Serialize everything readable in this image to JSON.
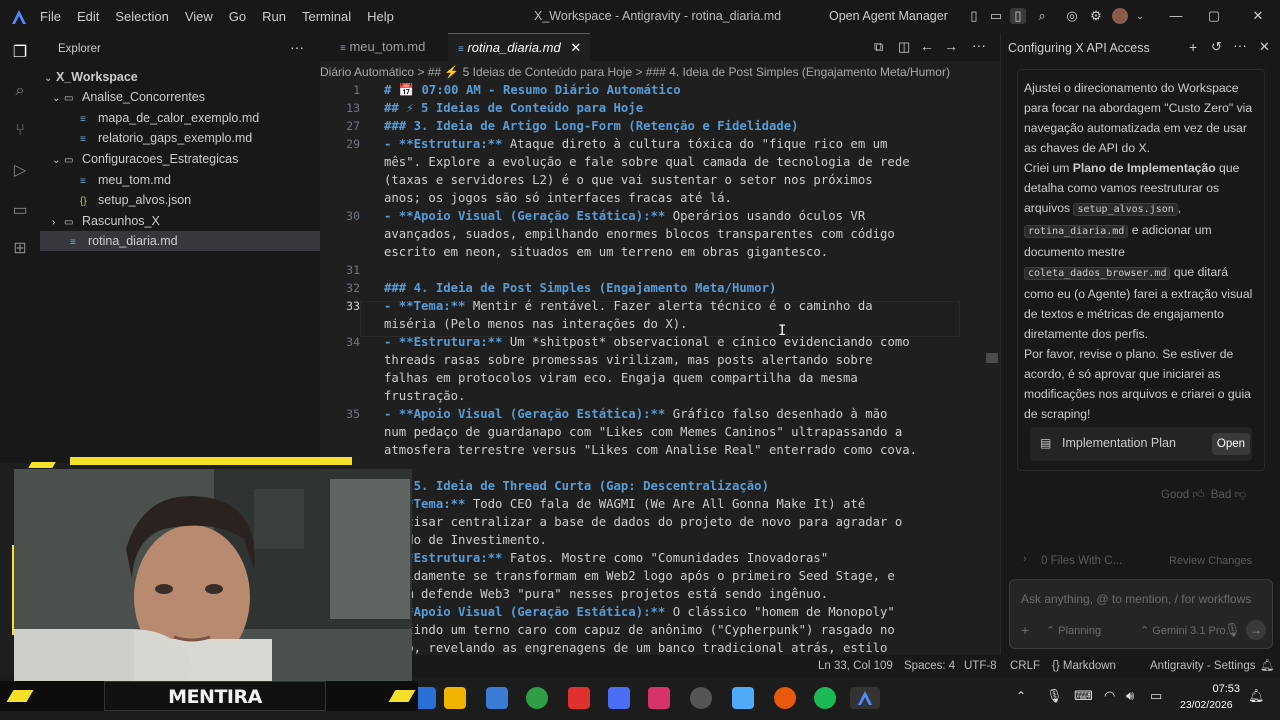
{
  "titlebar": {
    "menu": [
      "File",
      "Edit",
      "Selection",
      "View",
      "Go",
      "Run",
      "Terminal",
      "Help"
    ],
    "title": "X_Workspace - Antigravity - rotina_diaria.md",
    "agent_manager": "Open Agent Manager"
  },
  "explorer": {
    "title": "Explorer",
    "root": "X_Workspace",
    "items": [
      {
        "label": "Analise_Concorrentes",
        "type": "folder",
        "open": true
      },
      {
        "label": "mapa_de_calor_exemplo.md",
        "type": "md"
      },
      {
        "label": "relatorio_gaps_exemplo.md",
        "type": "md"
      },
      {
        "label": "Configuracoes_Estrategicas",
        "type": "folder",
        "open": true
      },
      {
        "label": "meu_tom.md",
        "type": "md"
      },
      {
        "label": "setup_alvos.json",
        "type": "json"
      },
      {
        "label": "Rascunhos_X",
        "type": "folder",
        "open": false
      },
      {
        "label": "rotina_diaria.md",
        "type": "md",
        "selected": true
      }
    ]
  },
  "editor": {
    "tabs": [
      {
        "label": "meu_tom.md",
        "active": false
      },
      {
        "label": "rotina_diaria.md",
        "active": true
      }
    ],
    "breadcrumb": "Diário Automático > ## ⚡ 5 Ideias de Conteúdo para Hoje > ### 4. Ideia de Post Simples (Engajamento Meta/Humor)",
    "lines": [
      {
        "n": "1",
        "text": "# 📅 07:00 AM - Resumo Diário Automático",
        "heading": true
      },
      {
        "n": "13",
        "text": "## ⚡ 5 Ideias de Conteúdo para Hoje",
        "heading": true
      },
      {
        "n": "27",
        "text": "### 3. Ideia de Artigo Long-Form (Retenção e Fidelidade)",
        "heading": true
      },
      {
        "n": "29",
        "bold": "- **Estrutura:**",
        "text": " Ataque direto à cultura tóxica do \"fique rico em um"
      },
      {
        "n": "",
        "text": "mês\". Explore a evolução e fale sobre qual camada de tecnologia de rede"
      },
      {
        "n": "",
        "text": "(taxas e servidores L2) é o que vai sustentar o setor nos próximos"
      },
      {
        "n": "",
        "text": "anos; os jogos são só interfaces fracas até lá."
      },
      {
        "n": "30",
        "bold": "- **Apoio Visual (Geração Estática):**",
        "text": " Operários usando óculos VR"
      },
      {
        "n": "",
        "text": "avançados, suados, empilhando enormes blocos transparentes com código"
      },
      {
        "n": "",
        "text": "escrito em neon, situados em um terreno em obras gigantesco."
      },
      {
        "n": "31",
        "text": ""
      },
      {
        "n": "32",
        "text": "### 4. Ideia de Post Simples (Engajamento Meta/Humor)",
        "heading": true
      },
      {
        "n": "33",
        "bold": "- **Tema:**",
        "text": " Mentir é rentável. Fazer alerta técnico é o caminho da"
      },
      {
        "n": "",
        "text": "miséria (Pelo menos nas interações do X)."
      },
      {
        "n": "34",
        "bold": "- **Estrutura:**",
        "text": " Um *shitpost* observacional e cínico evidenciando como"
      },
      {
        "n": "",
        "text": "threads rasas sobre promessas virilizam, mas posts alertando sobre"
      },
      {
        "n": "",
        "text": "falhas em protocolos viram eco. Engaja quem compartilha da mesma"
      },
      {
        "n": "",
        "text": "frustração."
      },
      {
        "n": "35",
        "bold": "- **Apoio Visual (Geração Estática):**",
        "text": " Gráfico falso desenhado à mão"
      },
      {
        "n": "",
        "text": "num pedaço de guardanapo com \"Likes com Memes Caninos\" ultrapassando a"
      },
      {
        "n": "",
        "text": "atmosfera terrestre versus \"Likes com Analise Real\" enterrado como cova."
      },
      {
        "n": "",
        "text": ""
      },
      {
        "n": "",
        "text": "### 5. Ideia de Thread Curta (Gap: Descentralização)",
        "heading": true
      },
      {
        "n": "",
        "bold": "- **Tema:**",
        "text": " Todo CEO fala de WAGMI (We Are All Gonna Make It) até"
      },
      {
        "n": "",
        "text": "precisar centralizar a base de dados do projeto de novo para agradar o"
      },
      {
        "n": "",
        "text": "Fundo de Investimento."
      },
      {
        "n": "",
        "bold": "- **Estrutura:**",
        "text": " Fatos. Mostre como \"Comunidades Inovadoras\""
      },
      {
        "n": "",
        "text": "rapidamente se transformam em Web2 logo após o primeiro Seed Stage, e"
      },
      {
        "n": "",
        "text": "quem defende Web3 \"pura\" nesses projetos está sendo ingênuo."
      },
      {
        "n": "",
        "bold": "- **Apoio Visual (Geração Estática):**",
        "text": " O clássico \"homem de Monopoly\""
      },
      {
        "n": "",
        "text": "vestindo um terno caro com capuz de anônimo (\"Cypherpunk\") rasgado no"
      },
      {
        "n": "",
        "text": "meio, revelando as engrenagens de um banco tradicional atrás, estilo"
      }
    ]
  },
  "agent": {
    "title": "Configuring X API Access",
    "message": {
      "p1": "Ajustei o direcionamento do Workspace para focar na abordagem \"Custo Zero\" via navegação automatizada em vez de usar as chaves de API do X.",
      "p2_a": "Criei um ",
      "p2_b": "Plano de Implementação",
      "p2_c": " que detalha como vamos reestruturar os arquivos ",
      "file1": "setup_alvos.json",
      "file2": "rotina_diaria.md",
      "p2_d": " e adicionar um documento mestre ",
      "file3": "coleta_dados_browser.md",
      "p2_e": " que ditará como eu (o Agente) farei a extração visual de textos e métricas de engajamento diretamente dos perfis.",
      "p3": "Por favor, revise o plano. Se estiver de acordo, é só aprovar que iniciarei as modificações nos arquivos e criarei o guia de scraping!"
    },
    "plan_label": "Implementation Plan",
    "plan_open": "Open",
    "good": "Good",
    "bad": "Bad",
    "files_changed": "0 Files With C...",
    "review_changes": "Review Changes",
    "ask_placeholder": "Ask anything, @ to mention, / for workflows",
    "mode": "Planning",
    "model": "Gemini 3.1 Pro..."
  },
  "status": {
    "position": "Ln 33, Col 109",
    "spaces": "Spaces: 4",
    "encoding": "UTF-8",
    "eol": "CRLF",
    "language": "Markdown",
    "settings": "Antigravity - Settings"
  },
  "taskbar": {
    "time": "07:53",
    "date": "23/02/2026"
  },
  "webcam": {
    "label": "MENTIRA"
  },
  "colors": {
    "accent": "#0078d4",
    "heading": "#569cd6",
    "webcam_accent": "#f5e12a"
  }
}
